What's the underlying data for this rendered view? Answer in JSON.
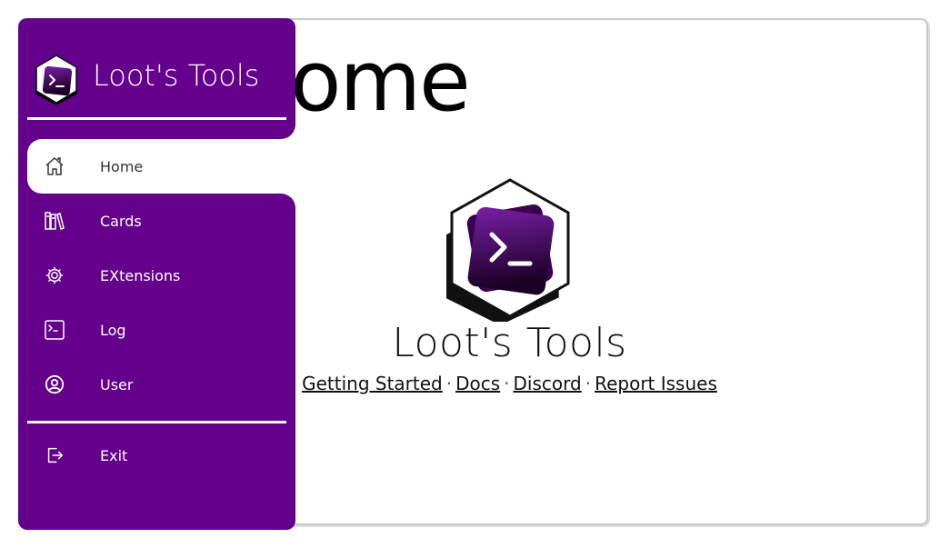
{
  "app": {
    "title": "Loot's Tools"
  },
  "colors": {
    "sidebar": "#64008c",
    "logo_gradient_top": "#7a1fa8",
    "logo_gradient_bottom": "#1a0024",
    "text": "#111111"
  },
  "page": {
    "heading": "Home",
    "hero_title": "Loot's Tools",
    "links": [
      {
        "label": "Getting Started"
      },
      {
        "label": "Docs"
      },
      {
        "label": "Discord"
      },
      {
        "label": "Report Issues"
      }
    ],
    "separator": "·"
  },
  "sidebar": {
    "brand_name": "Loot's Tools",
    "items": [
      {
        "label": "Home",
        "icon": "home-icon",
        "active": true
      },
      {
        "label": "Cards",
        "icon": "library-icon"
      },
      {
        "label": "EXtensions",
        "icon": "gear-icon"
      },
      {
        "label": "Log",
        "icon": "terminal-icon"
      },
      {
        "label": "User",
        "icon": "user-circle-icon"
      }
    ],
    "exit": {
      "label": "Exit",
      "icon": "logout-icon"
    }
  }
}
